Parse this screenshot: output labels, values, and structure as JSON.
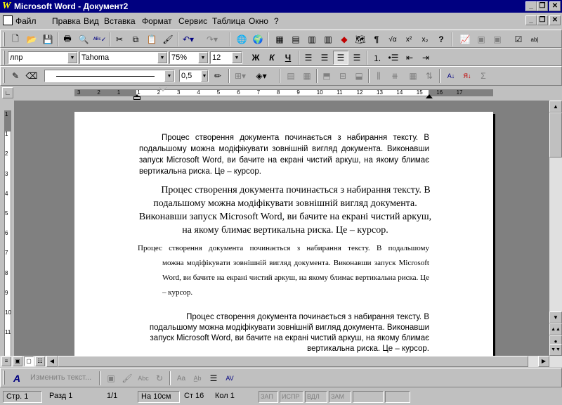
{
  "window": {
    "title": "Microsoft Word - Документ2",
    "logo": "W"
  },
  "menu": [
    "Файл",
    "Правка",
    "Вид",
    "Вставка",
    "Формат",
    "Сервис",
    "Таблица",
    "Окно",
    "?"
  ],
  "formatting": {
    "style": "лпр",
    "font": "Tahoma",
    "zoom": "75%",
    "size": "12",
    "bold": "Ж",
    "italic": "К",
    "underline": "Ч"
  },
  "drawing_tb": {
    "line_weight": "0,5"
  },
  "ruler": {
    "labels": [
      "3",
      "2",
      "1",
      "1",
      "2",
      "3",
      "4",
      "5",
      "6",
      "7",
      "8",
      "9",
      "10",
      "11",
      "12",
      "13",
      "14",
      "15",
      "16",
      "17"
    ]
  },
  "vruler": {
    "labels": [
      "1",
      "1",
      "2",
      "3",
      "4",
      "5",
      "6",
      "7",
      "8",
      "9",
      "10",
      "11"
    ]
  },
  "document": {
    "p1": "Процес створення документа починається з набирання тексту. В подальшому можна модіфікувати зовнішній вигляд документа. Виконавши запуск Microsoft Word, ви бачите на екрані чистий аркуш, на якому блимає вертикальна риска. Це – курсор.",
    "p2": "Процес створення документа починається з набирання тексту. В подальшому можна модіфікувати зовнішній вигляд документа. Виконавши запуск Microsoft Word, ви бачите на екрані чистий аркуш, на якому блимає вертикальна риска. Це – курсор.",
    "p3_first": "Процес створення документа починається з набирання тексту. В подальшому",
    "p3_rest": "можна модіфікувати зовнішній вигляд документа. Виконавши запуск Microsoft Word, ви бачите на екрані чистий аркуш, на якому блимає вертикальна риска. Це – курсор.",
    "p4": "Процес створення документа починається з набирання тексту. В подальшому можна модіфікувати зовнішній вигляд документа. Виконавши запуск Microsoft Word, ви бачите на екрані чистий аркуш, на якому блимає вертикальна риска. Це – курсор."
  },
  "drawbar": {
    "change_text": "Изменить текст..."
  },
  "status": {
    "page": "Стр. 1",
    "section": "Разд 1",
    "pages": "1/1",
    "at": "На 10см",
    "line": "Ст 16",
    "col": "Кол 1",
    "rec": "ЗАП",
    "trk": "ИСПР",
    "ext": "ВДЛ",
    "ovr": "ЗАМ"
  }
}
